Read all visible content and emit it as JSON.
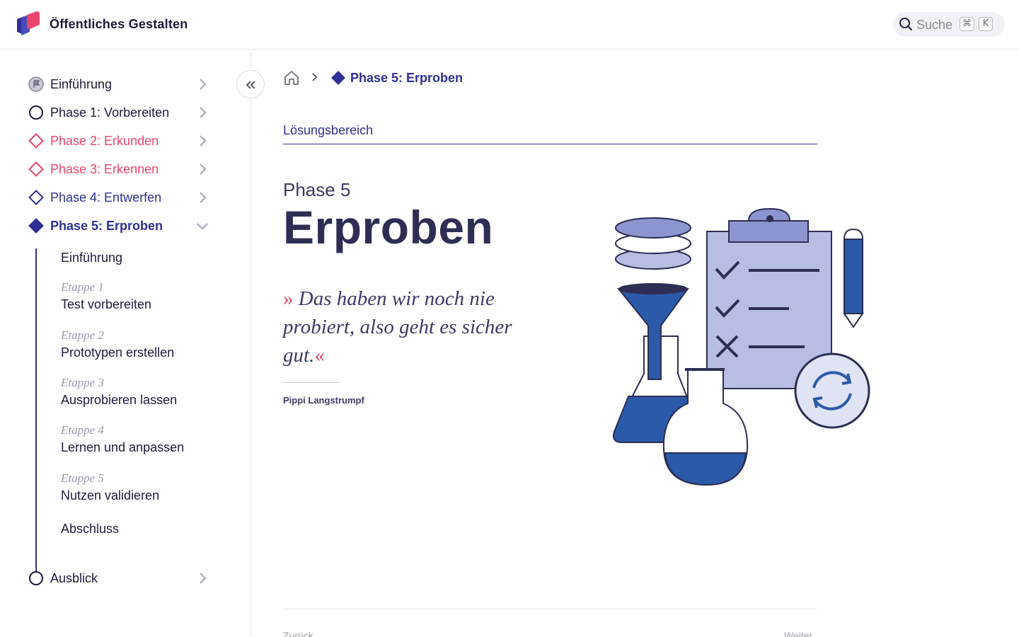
{
  "header": {
    "site_title": "Öffentliches Gestalten",
    "search": {
      "placeholder": "Suche",
      "shortcut_mod": "⌘",
      "shortcut_key": "K"
    }
  },
  "sidebar": {
    "items": [
      {
        "label": "Einführung",
        "marker": "flag-icon",
        "color": "#1b1b3a"
      },
      {
        "label": "Phase 1: Vorbereiten",
        "marker": "circle-icon",
        "color": "#1b1b3a"
      },
      {
        "label": "Phase 2: Erkunden",
        "marker": "diamond-outline-icon",
        "color": "#e8466b"
      },
      {
        "label": "Phase 3: Erkennen",
        "marker": "diamond-outline-icon",
        "color": "#e8466b"
      },
      {
        "label": "Phase 4: Entwerfen",
        "marker": "diamond-outline-icon",
        "color": "#2f2f96"
      },
      {
        "label": "Phase 5: Erproben",
        "marker": "diamond-filled-icon",
        "color": "#2f2f96",
        "active": true
      }
    ],
    "sub_items": [
      {
        "etappe": "",
        "name": "Einführung"
      },
      {
        "etappe": "Etappe 1",
        "name": "Test vorbereiten"
      },
      {
        "etappe": "Etappe 2",
        "name": "Prototypen erstellen"
      },
      {
        "etappe": "Etappe 3",
        "name": "Ausprobieren lassen"
      },
      {
        "etappe": "Etappe 4",
        "name": "Lernen und anpassen"
      },
      {
        "etappe": "Etappe 5",
        "name": "Nutzen validieren"
      },
      {
        "etappe": "",
        "name": "Abschluss"
      }
    ],
    "last_item": {
      "label": "Ausblick",
      "marker": "circle-icon",
      "color": "#1b1b3a"
    }
  },
  "breadcrumb": {
    "current": "Phase 5: Erproben"
  },
  "main": {
    "section_label": "Lösungsbereich",
    "phase_kicker": "Phase 5",
    "phase_title": "Erproben",
    "quote": {
      "open_mark": "»",
      "text": " Das haben wir noch nie probiert, also geht es sicher gut.",
      "close_mark": "«",
      "author": "Pippi Langstrumpf"
    }
  },
  "footer": {
    "prev": "Zurück",
    "next": "Weiter"
  },
  "colors": {
    "accent_blue": "#2f2f96",
    "accent_pink": "#e8466b",
    "ink": "#1b1b3a"
  }
}
